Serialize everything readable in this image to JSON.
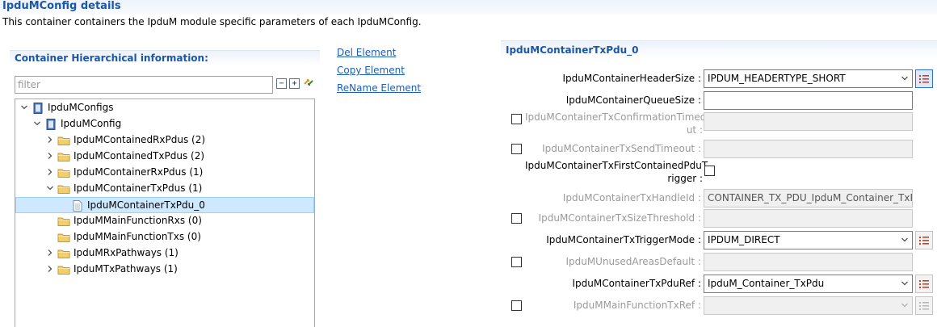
{
  "page": {
    "title": "IpduMConfig details",
    "description": "This container containers the IpduM module specific parameters of each IpduMConfig."
  },
  "left_panel": {
    "title": "Container Hierarchical information:",
    "filter_placeholder": "filter",
    "tree": [
      {
        "label": "IpduMConfigs",
        "icon": "module-icon",
        "expander": "expanded",
        "depth": 0
      },
      {
        "label": "IpduMConfig",
        "icon": "module-icon",
        "expander": "expanded",
        "depth": 1
      },
      {
        "label": "IpduMContainedRxPdus (2)",
        "icon": "folder-icon",
        "expander": "collapsed",
        "depth": 2
      },
      {
        "label": "IpduMContainedTxPdus (2)",
        "icon": "folder-icon",
        "expander": "collapsed",
        "depth": 2
      },
      {
        "label": "IpduMContainerRxPdus (1)",
        "icon": "folder-icon",
        "expander": "collapsed",
        "depth": 2
      },
      {
        "label": "IpduMContainerTxPdus (1)",
        "icon": "folder-icon",
        "expander": "expanded",
        "depth": 2
      },
      {
        "label": "IpduMContainerTxPdu_0",
        "icon": "document-icon",
        "expander": "none",
        "depth": 3,
        "selected": true
      },
      {
        "label": "IpduMMainFunctionRxs (0)",
        "icon": "folder-icon",
        "expander": "none",
        "depth": 2
      },
      {
        "label": "IpduMMainFunctionTxs (0)",
        "icon": "folder-icon",
        "expander": "none",
        "depth": 2
      },
      {
        "label": "IpduMRxPathways (1)",
        "icon": "folder-icon",
        "expander": "collapsed",
        "depth": 2
      },
      {
        "label": "IpduMTxPathways (1)",
        "icon": "folder-icon",
        "expander": "collapsed",
        "depth": 2
      }
    ]
  },
  "actions": {
    "del": "Del Element",
    "copy": "Copy Element",
    "rename": "ReName Element"
  },
  "right_panel": {
    "title": "IpduMContainerTxPdu_0",
    "params": [
      {
        "label": "IpduMContainerHeaderSize :",
        "value": "IPDUM_HEADERTYPE_SHORT",
        "enabled": true,
        "control": "combo",
        "has_list_button": true,
        "has_checkbox": false
      },
      {
        "label": "IpduMContainerQueueSize :",
        "value": "",
        "enabled": true,
        "control": "text",
        "has_list_button": false,
        "has_checkbox": false
      },
      {
        "label_lines": [
          "IpduMContainerTxConfirmationTimeo",
          "ut :"
        ],
        "value": "",
        "enabled": false,
        "control": "text",
        "has_list_button": false,
        "has_checkbox": true
      },
      {
        "label": "IpduMContainerTxSendTimeout :",
        "value": "",
        "enabled": false,
        "control": "text",
        "has_list_button": false,
        "has_checkbox": true
      },
      {
        "label_lines": [
          "IpduMContainerTxFirstContainedPduT",
          "rigger :"
        ],
        "value": "",
        "enabled": true,
        "control": "checkbox",
        "has_list_button": false,
        "has_checkbox": false
      },
      {
        "label": "IpduMContainerTxHandleId :",
        "value": "CONTAINER_TX_PDU_IpduM_Container_TxP",
        "enabled": false,
        "control": "text",
        "has_list_button": false,
        "has_checkbox": false
      },
      {
        "label": "IpduMContainerTxSizeThreshold :",
        "value": "",
        "enabled": false,
        "control": "text",
        "has_list_button": false,
        "has_checkbox": true
      },
      {
        "label": "IpduMContainerTxTriggerMode :",
        "value": "IPDUM_DIRECT",
        "enabled": true,
        "control": "combo",
        "has_list_button": true,
        "has_checkbox": false
      },
      {
        "label": "IpduMUnusedAreasDefault :",
        "value": "",
        "enabled": false,
        "control": "text",
        "has_list_button": false,
        "has_checkbox": true
      },
      {
        "label": "IpduMContainerTxPduRef :",
        "value": "IpduM_Container_TxPdu",
        "enabled": true,
        "control": "combo",
        "has_list_button": true,
        "has_checkbox": false
      },
      {
        "label": "IpduMMainFunctionTxRef :",
        "value": "",
        "enabled": false,
        "control": "combo",
        "has_list_button": true,
        "has_checkbox": true
      }
    ]
  },
  "colors": {
    "title_blue": "#1a57a8",
    "link_blue": "#1c5db8",
    "selection": "#cde8ff",
    "folder_yellow": "#f2cf6b",
    "disabled_text": "#9a9a9a",
    "list_button_red": "#d04020"
  }
}
